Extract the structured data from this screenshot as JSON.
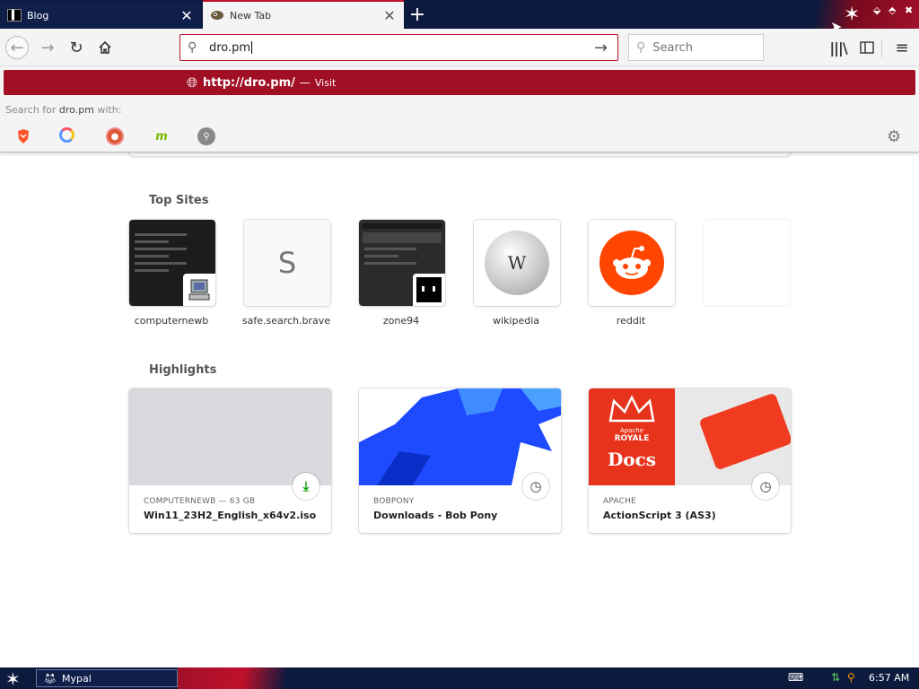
{
  "tabs": [
    {
      "title": "Blog",
      "favicon": "terminal-icon",
      "active": false
    },
    {
      "title": "New Tab",
      "favicon": "firefox-icon",
      "active": true
    }
  ],
  "navbar": {
    "url_value": "dro.pm",
    "search_placeholder": "Search"
  },
  "dropdown": {
    "visit_url": "http://dro.pm/",
    "visit_dash": "—",
    "visit_label": "Visit",
    "search_with_prefix": "Search for",
    "search_with_term": "dro.pm",
    "search_with_suffix": "with:",
    "engines": [
      "brave-icon",
      "qwant-icon",
      "duckduckgo-icon",
      "mojeek-icon",
      "search-engine-icon"
    ],
    "engine_mojeek_letter": "m"
  },
  "top_sites": {
    "title": "Top Sites",
    "items": [
      {
        "label": "computernewb"
      },
      {
        "label": "safe.search.brave",
        "letter": "S"
      },
      {
        "label": "zone94"
      },
      {
        "label": "wikipedia"
      },
      {
        "label": "reddit"
      },
      {
        "label": ""
      }
    ]
  },
  "highlights": {
    "title": "Highlights",
    "cards": [
      {
        "source": "COMPUTERNEWB — 63 GB",
        "title": "Win11_23H2_English_x64v2.iso",
        "icon": "download-icon",
        "image_color": "#d8d8de"
      },
      {
        "source": "BOBPONY",
        "title": "Downloads - Bob Pony",
        "icon": "clock-icon",
        "image_color": "#1e4bff"
      },
      {
        "source": "APACHE",
        "title": "ActionScript 3 (AS3)",
        "icon": "clock-icon",
        "image_color": "#e8331c"
      }
    ],
    "apache_card": {
      "brand_line1": "Apache",
      "brand_line2": "ROYALE",
      "docs_label": "Docs"
    }
  },
  "taskbar": {
    "task_label": "Mypal",
    "clock": "6:57 AM"
  },
  "colors": {
    "accent": "#a00f24",
    "titlebar": "#0c1a3e",
    "reddit": "#ff4500"
  }
}
